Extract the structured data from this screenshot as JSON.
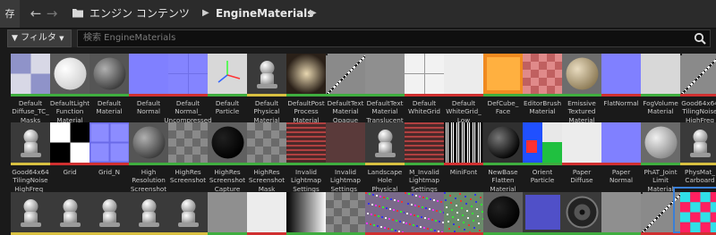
{
  "toolbar": {
    "save_tab": "存",
    "breadcrumb": [
      "エンジン コンテンツ",
      "EngineMaterials"
    ],
    "filter_label": "フィルタ",
    "search_placeholder": "検索 EngineMaterials"
  },
  "rows": [
    [
      {
        "label": "Default\nDiffuse_TC_\nMasks",
        "kind": "checker",
        "stripe": "#3fae3f"
      },
      {
        "label": "DefaultLight\nFunction\nMaterial",
        "kind": "white-sphere",
        "stripe": "#3fae3f"
      },
      {
        "label": "Default\nMaterial",
        "kind": "grey-sphere",
        "stripe": "#3fae3f"
      },
      {
        "label": "Default\nNormal",
        "kind": "normal",
        "stripe": "#d03030"
      },
      {
        "label": "Default\nNormal_\nUncompressed",
        "kind": "normal2",
        "stripe": "#d03030"
      },
      {
        "label": "Default\nParticle",
        "kind": "particle",
        "stripe": "#3fae3f"
      },
      {
        "label": "Default\nPhysical\nMaterial",
        "kind": "pawn",
        "stripe": "#d8c040"
      },
      {
        "label": "DefaultPost\nProcess\nMaterial",
        "kind": "vignette",
        "stripe": "#3fae3f"
      },
      {
        "label": "DefaultText\nMaterial\nOpaque",
        "kind": "noise",
        "stripe": "#3fae3f"
      },
      {
        "label": "DefaultText\nMaterial\nTranslucent",
        "kind": "grey-flat",
        "stripe": "#3fae3f"
      },
      {
        "label": "Default\nWhiteGrid",
        "kind": "white-grid",
        "stripe": "#d03030"
      },
      {
        "label": "Default\nWhiteGrid_\nLow",
        "kind": "white",
        "stripe": "#d03030"
      },
      {
        "label": "DefCube_\nFace",
        "kind": "orange",
        "stripe": "#3fae3f"
      },
      {
        "label": "EditorBrush\nMaterial",
        "kind": "red-check",
        "stripe": "#3fae3f"
      },
      {
        "label": "Emissive\nTextured\nMaterial",
        "kind": "tan-sphere",
        "stripe": "#3fae3f"
      },
      {
        "label": "FlatNormal",
        "kind": "normal",
        "stripe": "#d03030"
      },
      {
        "label": "FogVolume\nMaterial",
        "kind": "light",
        "stripe": "#3fae3f"
      },
      {
        "label": "Good64x64\nTilingNoise\nHighFreq",
        "kind": "noise",
        "stripe": "#d03030"
      }
    ],
    [
      {
        "label": "Good64x64\nTilingNoise\nHighFreq_",
        "kind": "pawn",
        "stripe": "#d8c040"
      },
      {
        "label": "Grid",
        "kind": "bw-check",
        "stripe": "#d03030"
      },
      {
        "label": "Grid_N",
        "kind": "normal-grid",
        "stripe": "#d03030"
      },
      {
        "label": "High\nResolution\nScreenshot",
        "kind": "grey-sphere",
        "stripe": "#3fae3f"
      },
      {
        "label": "HighRes\nScreenshot",
        "kind": "check-grey",
        "stripe": "#3fae3f"
      },
      {
        "label": "HighRes\nScreenshot\nCapture",
        "kind": "black-sphere",
        "stripe": "#3fae3f"
      },
      {
        "label": "HighRes\nScreenshot\nMask",
        "kind": "check-grey",
        "stripe": "#3fae3f"
      },
      {
        "label": "Invalid\nLightmap\nSettings",
        "kind": "stripes-red",
        "stripe": "#3fae3f"
      },
      {
        "label": "Invalid\nLightmap\nSettings_",
        "kind": "dark-red",
        "stripe": "#3fae3f"
      },
      {
        "label": "Landscape\nHole\nPhysical",
        "kind": "pawn",
        "stripe": "#d8c040"
      },
      {
        "label": "M_Invalid\nLightmap\nSettings",
        "kind": "stripes-red",
        "stripe": "#3fae3f"
      },
      {
        "label": "MiniFont",
        "kind": "barcode",
        "stripe": "#d03030"
      },
      {
        "label": "NewBase\nFlatten\nMaterial",
        "kind": "black-sphere-shine",
        "stripe": "#3fae3f"
      },
      {
        "label": "Orient\nParticle",
        "kind": "orient",
        "stripe": "#3fae3f"
      },
      {
        "label": "Paper\nDiffuse",
        "kind": "white",
        "stripe": "#d03030"
      },
      {
        "label": "Paper\nNormal",
        "kind": "normal",
        "stripe": "#d03030"
      },
      {
        "label": "PhAT_Joint\nLimit\nMaterial",
        "kind": "light-sphere",
        "stripe": "#3fae3f"
      },
      {
        "label": "PhysMat_\nCarboard",
        "kind": "pawn",
        "stripe": "#d8c040"
      }
    ],
    [
      {
        "label": "",
        "kind": "pawn",
        "stripe": "#d8c040"
      },
      {
        "label": "",
        "kind": "pawn",
        "stripe": "#d8c040"
      },
      {
        "label": "",
        "kind": "pawn",
        "stripe": "#d8c040"
      },
      {
        "label": "",
        "kind": "pawn",
        "stripe": "#d8c040"
      },
      {
        "label": "",
        "kind": "pawn",
        "stripe": "#d8c040"
      },
      {
        "label": "",
        "kind": "grey-flat",
        "stripe": "#3fae3f"
      },
      {
        "label": "",
        "kind": "white",
        "stripe": "#d03030"
      },
      {
        "label": "",
        "kind": "gradient",
        "stripe": "#3fae3f"
      },
      {
        "label": "",
        "kind": "check-grey",
        "stripe": "#3fae3f"
      },
      {
        "label": "",
        "kind": "noise-color",
        "stripe": "#d03030"
      },
      {
        "label": "",
        "kind": "noise-color",
        "stripe": "#d03030"
      },
      {
        "label": "",
        "kind": "noise-color2",
        "stripe": "#d03030"
      },
      {
        "label": "",
        "kind": "black-sphere",
        "stripe": "#3fae3f"
      },
      {
        "label": "",
        "kind": "blue-square",
        "stripe": "#3fae3f"
      },
      {
        "label": "",
        "kind": "speaker",
        "stripe": "#3fae3f"
      },
      {
        "label": "",
        "kind": "grey-flat",
        "stripe": "#3fae3f"
      },
      {
        "label": "",
        "kind": "noise",
        "stripe": "#d03030"
      },
      {
        "label": "",
        "kind": "cyan-check",
        "stripe": "#d03030"
      }
    ]
  ],
  "colors": {
    "selection": "#3a7fd6",
    "accent_green": "#3fae3f",
    "accent_red": "#d03030",
    "accent_yellow": "#d8c040"
  }
}
